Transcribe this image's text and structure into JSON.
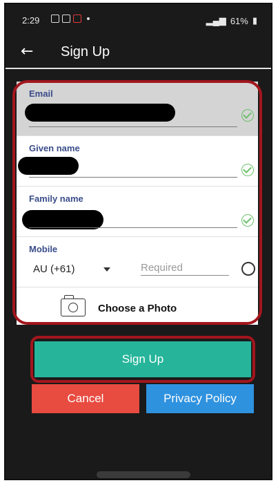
{
  "status_bar": {
    "time": "2:29",
    "battery": "61%"
  },
  "app_bar": {
    "title": "Sign Up"
  },
  "form": {
    "email": {
      "label": "Email",
      "valid": true
    },
    "given_name": {
      "label": "Given name",
      "valid": true
    },
    "family_name": {
      "label": "Family name",
      "valid": true
    },
    "mobile": {
      "label": "Mobile",
      "country_code": "AU (+61)",
      "placeholder": "Required",
      "valid": false
    },
    "photo": {
      "label": "Choose a Photo"
    }
  },
  "buttons": {
    "sign_up": "Sign Up",
    "cancel": "Cancel",
    "privacy": "Privacy Policy"
  },
  "colors": {
    "sign_up": "#26b59a",
    "cancel": "#e84b40",
    "privacy": "#2f92df",
    "highlight": "#a3161d",
    "label": "#3a4d8a"
  },
  "icons": [
    "back-arrow-icon",
    "check-circle-icon",
    "dropdown-arrow-icon",
    "camera-icon",
    "empty-circle-icon"
  ]
}
